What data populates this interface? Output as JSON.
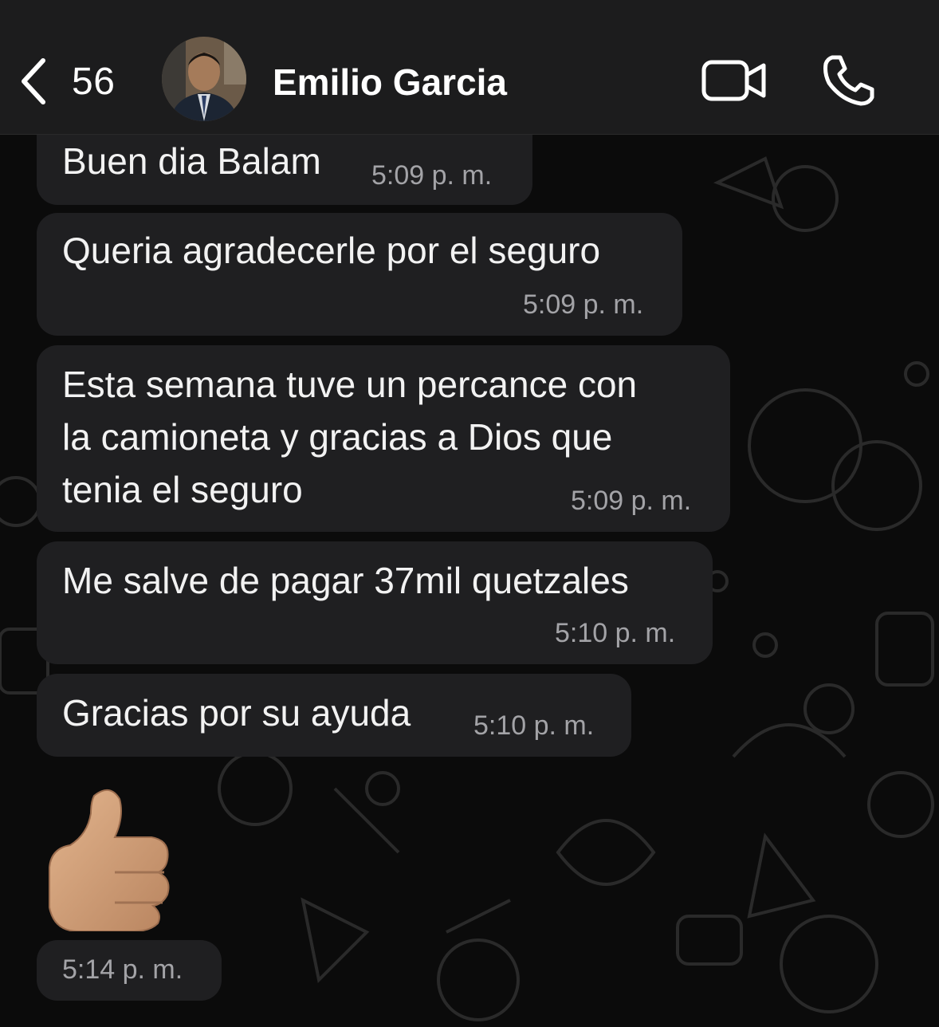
{
  "header": {
    "back_count": "56",
    "contact_name": "Emilio Garcia",
    "icons": {
      "back": "chevron-left-icon",
      "video": "video-camera-icon",
      "call": "phone-icon"
    }
  },
  "messages": [
    {
      "text": "Buen dia Balam",
      "time": "5:09 p. m."
    },
    {
      "text": "Queria agradecerle por el seguro",
      "time": "5:09 p. m."
    },
    {
      "lines": [
        "Esta semana tuve un percance con",
        "la camioneta y gracias a Dios que",
        "tenia el seguro"
      ],
      "time": "5:09 p. m."
    },
    {
      "text": "Me salve de pagar 37mil quetzales",
      "time": "5:10 p. m."
    },
    {
      "text": "Gracias por su ayuda",
      "time": "5:10 p. m."
    },
    {
      "emoji": "thumbs-up",
      "time": "5:14 p. m."
    }
  ],
  "colors": {
    "header_bg": "#1c1c1d",
    "chat_bg": "#0b0b0b",
    "bubble_bg": "#1f1f21",
    "time_text": "#a3a3a7"
  }
}
